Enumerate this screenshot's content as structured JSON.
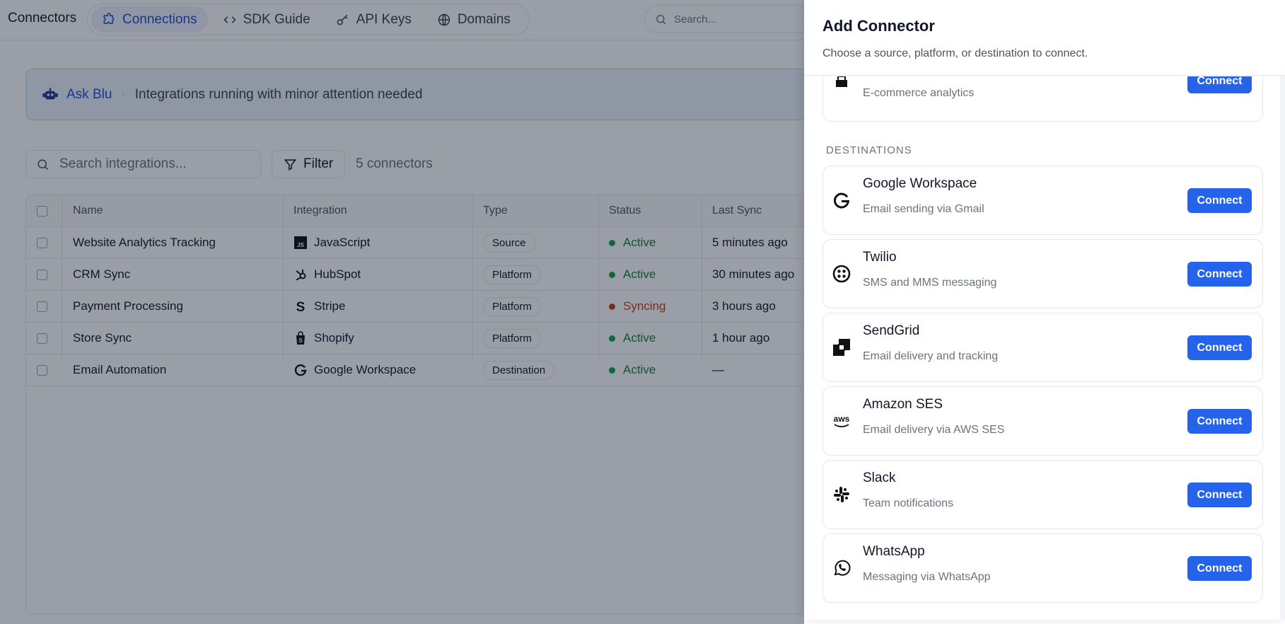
{
  "app": {
    "title": "Connectors",
    "nav": [
      {
        "label": "Connections",
        "icon": "puzzle-icon",
        "active": true
      },
      {
        "label": "SDK Guide",
        "icon": "code-icon",
        "active": false
      },
      {
        "label": "API Keys",
        "icon": "key-icon",
        "active": false
      },
      {
        "label": "Domains",
        "icon": "globe-icon",
        "active": false
      }
    ],
    "search_placeholder": "Search..."
  },
  "banner": {
    "name": "Ask Blu",
    "separator": "·",
    "message": "Integrations running with minor attention needed"
  },
  "toolbar": {
    "search_placeholder": "Search integrations...",
    "filter_label": "Filter",
    "count_label": "5 connectors"
  },
  "table": {
    "columns": [
      "Name",
      "Integration",
      "Type",
      "Status",
      "Last Sync"
    ],
    "rows": [
      {
        "name": "Website Analytics Tracking",
        "integration": "JavaScript",
        "integration_icon": "javascript-icon",
        "type": "Source",
        "status": "Active",
        "last_sync": "5 minutes ago"
      },
      {
        "name": "CRM Sync",
        "integration": "HubSpot",
        "integration_icon": "hubspot-icon",
        "type": "Platform",
        "status": "Active",
        "last_sync": "30 minutes ago"
      },
      {
        "name": "Payment Processing",
        "integration": "Stripe",
        "integration_icon": "stripe-icon",
        "type": "Platform",
        "status": "Syncing",
        "last_sync": "3 hours ago"
      },
      {
        "name": "Store Sync",
        "integration": "Shopify",
        "integration_icon": "shopify-icon",
        "type": "Platform",
        "status": "Active",
        "last_sync": "1 hour ago"
      },
      {
        "name": "Email Automation",
        "integration": "Google Workspace",
        "integration_icon": "google-icon",
        "type": "Destination",
        "status": "Active",
        "last_sync": "—"
      }
    ]
  },
  "colors": {
    "accent": "#2563eb",
    "active": "#16a34a",
    "syncing": "#c2410c"
  },
  "drawer": {
    "title": "Add Connector",
    "subtitle": "Choose a source, platform, or destination to connect.",
    "partial_card": {
      "description": "E-commerce analytics",
      "button": "Connect"
    },
    "section_label": "DESTINATIONS",
    "destinations": [
      {
        "name": "Google Workspace",
        "description": "Email sending via Gmail",
        "icon": "google-icon",
        "button": "Connect"
      },
      {
        "name": "Twilio",
        "description": "SMS and MMS messaging",
        "icon": "twilio-icon",
        "button": "Connect"
      },
      {
        "name": "SendGrid",
        "description": "Email delivery and tracking",
        "icon": "sendgrid-icon",
        "button": "Connect"
      },
      {
        "name": "Amazon SES",
        "description": "Email delivery via AWS SES",
        "icon": "aws-icon",
        "button": "Connect"
      },
      {
        "name": "Slack",
        "description": "Team notifications",
        "icon": "slack-icon",
        "button": "Connect"
      },
      {
        "name": "WhatsApp",
        "description": "Messaging via WhatsApp",
        "icon": "whatsapp-icon",
        "button": "Connect"
      }
    ]
  }
}
